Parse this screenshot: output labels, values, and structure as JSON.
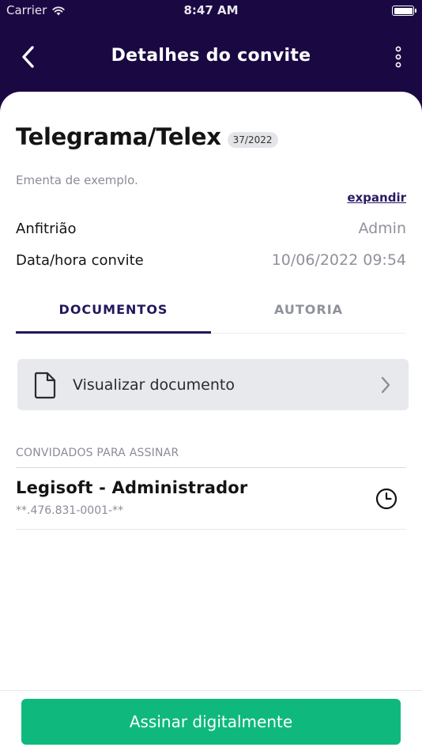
{
  "status_bar": {
    "carrier": "Carrier",
    "time": "8:47 AM"
  },
  "nav": {
    "title": "Detalhes do convite",
    "back_icon": "chevron-left-icon",
    "more_icon": "more-vertical-icon"
  },
  "invite": {
    "title": "Telegrama/Telex",
    "number": "37/2022",
    "ementa": "Ementa de exemplo.",
    "expand_label": "expandir",
    "host_label": "Anfitrião",
    "host_value": "Admin",
    "datetime_label": "Data/hora convite",
    "datetime_value": "10/06/2022 09:54"
  },
  "tabs": [
    {
      "label": "DOCUMENTOS",
      "active": true
    },
    {
      "label": "AUTORIA",
      "active": false
    }
  ],
  "document": {
    "label": "Visualizar documento",
    "icon": "document-icon"
  },
  "signers_section": {
    "header": "CONVIDADOS PARA ASSINAR",
    "items": [
      {
        "name": "Legisoft - Administrador",
        "doc": "**.476.831-0001-**",
        "status_icon": "clock-icon"
      }
    ]
  },
  "footer": {
    "sign_label": "Assinar digitalmente"
  },
  "colors": {
    "header_bg": "#1a0843",
    "accent": "#24165c",
    "primary_button": "#0fb97d"
  }
}
